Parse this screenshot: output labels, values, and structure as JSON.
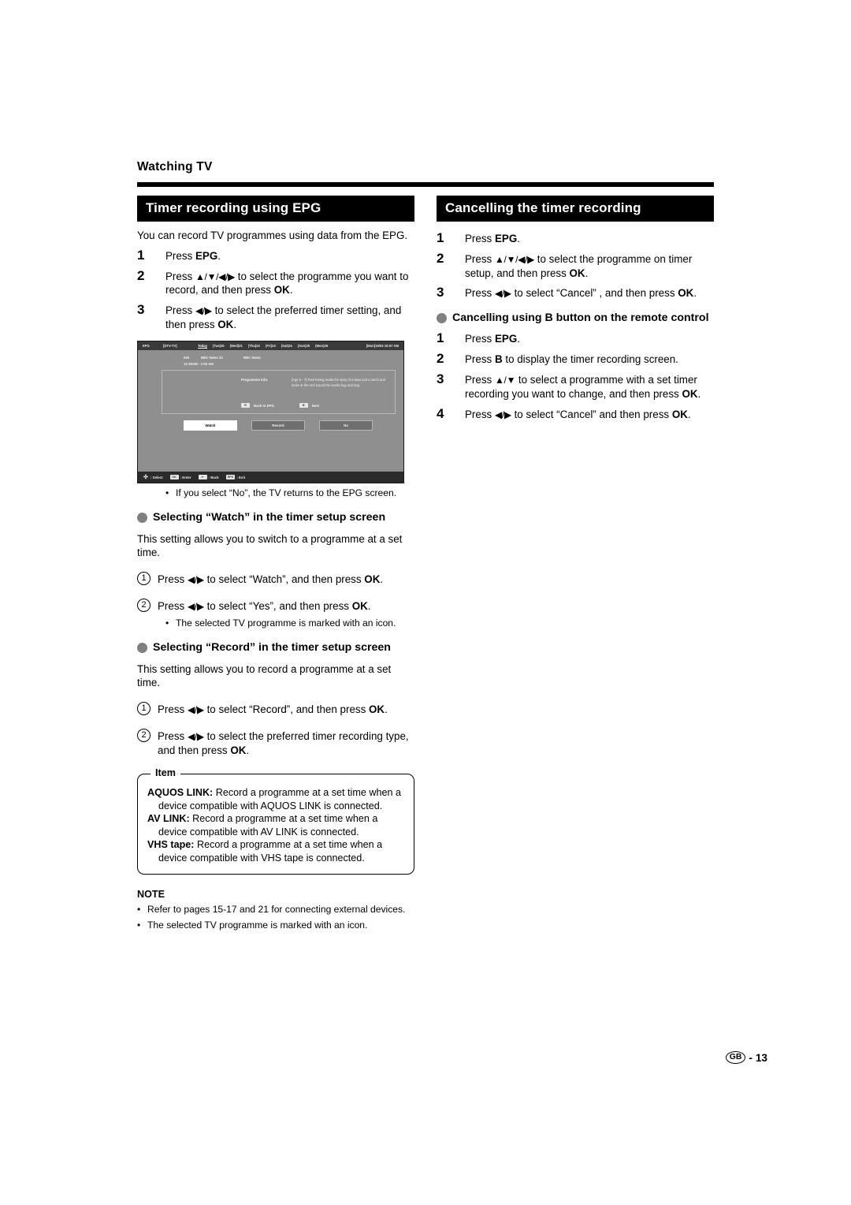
{
  "running_head": "Watching TV",
  "left": {
    "section_title": "Timer recording using EPG",
    "intro": "You can record TV programmes using data from the EPG.",
    "steps": [
      {
        "num": "1",
        "text_html": "Press <b>EPG</b>."
      },
      {
        "num": "2",
        "text_html": "Press <span class=\"arrows\">▲/▼/◀/▶</span> to select the programme you want to record, and then press <b>OK</b>."
      },
      {
        "num": "3",
        "text_html": "Press <span class=\"arrows\">◀/▶</span> to select the preferred timer setting, and then press <b>OK</b>."
      }
    ],
    "epg_note": "If you select “No”, the TV returns to the EPG screen.",
    "watch_section": {
      "heading": "Selecting “Watch” in the timer setup screen",
      "intro": "This setting allows you to switch to a programme at a set time.",
      "steps": [
        {
          "num": "1",
          "text_html": "Press <span class=\"arrows\">◀/▶</span> to select “Watch”, and then press <b>OK</b>."
        },
        {
          "num": "2",
          "text_html": "Press <span class=\"arrows\">◀/▶</span> to select “Yes”, and then press <b>OK</b>."
        }
      ],
      "note": "The selected TV programme is marked with an icon."
    },
    "record_section": {
      "heading": "Selecting “Record” in the timer setup screen",
      "intro": "This setting allows you to record a programme at a set time.",
      "steps": [
        {
          "num": "1",
          "text_html": "Press <span class=\"arrows\">◀/▶</span> to select “Record”, and then press <b>OK</b>."
        },
        {
          "num": "2",
          "text_html": "Press <span class=\"arrows\">◀/▶</span> to select the preferred timer recording type, and then press <b>OK</b>."
        }
      ]
    },
    "item_box": {
      "title": "Item",
      "entries": [
        {
          "term": "AQUOS LINK:",
          "desc": " Record a programme at a set time when a device compatible with AQUOS LINK is connected."
        },
        {
          "term": "AV LINK:",
          "desc": " Record a programme at a set time when a device compatible with AV LINK is connected."
        },
        {
          "term": "VHS tape:",
          "desc": " Record a programme at a set time when a device compatible with VHS tape is connected."
        }
      ]
    },
    "note": {
      "title": "NOTE",
      "bullets": [
        "Refer to pages 15-17 and 21 for connecting external devices.",
        "The selected TV programme is marked with an icon."
      ]
    }
  },
  "right": {
    "section_title": "Cancelling the timer recording",
    "steps": [
      {
        "num": "1",
        "text_html": "Press <b>EPG</b>."
      },
      {
        "num": "2",
        "text_html": "Press <span class=\"arrows\">▲/▼/◀/▶</span> to select the programme on timer setup, and then press <b>OK</b>."
      },
      {
        "num": "3",
        "text_html": "Press <span class=\"arrows\">◀/▶</span> to select “Cancel” , and then press <b>OK</b>."
      }
    ],
    "b_button_section": {
      "heading": "Cancelling using B button on the remote control",
      "steps": [
        {
          "num": "1",
          "text_html": "Press <b>EPG</b>."
        },
        {
          "num": "2",
          "text_html": "Press <b>B</b> to display the timer recording screen."
        },
        {
          "num": "3",
          "text_html": "Press <span class=\"arrows\">▲/▼</span> to select a programme with a set timer recording you want to change, and then press <b>OK</b>."
        },
        {
          "num": "4",
          "text_html": "Press <span class=\"arrows\">◀/▶</span> to select “Cancel” and then press <b>OK</b>."
        }
      ]
    }
  },
  "epg_screenshot": {
    "topbar": {
      "label": "EPG",
      "source": "[DTV-TV]",
      "days": [
        "Today",
        "(Tue)20",
        "(Wed)21",
        "(Thu)22",
        "(Fri)23",
        "(Sat)24",
        "(Sun)25",
        "(Mon)26"
      ],
      "today_index": 0,
      "clock": "[Mon]16/04 10:57 AM"
    },
    "programme": {
      "channel_number": "040",
      "channel_name": "BBC News 24",
      "programme_name": "BBC News",
      "time_range": "12:30AM - 1:00 AM",
      "info_label": "Programme Info.",
      "info_text": "[Age 5 - 7] Paul Ewing reads the story of a bear and a lunch and looks at the end sound the words bug and dog.",
      "key_back": "Back to EPG",
      "key_back_cap": "R",
      "key_next": "Next",
      "key_next_cap": "B"
    },
    "buttons": [
      {
        "label": "Watch",
        "selected": true
      },
      {
        "label": "Record",
        "selected": false
      },
      {
        "label": "No",
        "selected": false
      }
    ],
    "bottombar": [
      {
        "cap": "",
        "label": ": Select",
        "dpad": true
      },
      {
        "cap": "OK",
        "label": ": Enter"
      },
      {
        "cap": "↩",
        "label": ": Back"
      },
      {
        "cap": "EPG",
        "label": ": Exit"
      }
    ]
  },
  "footer": {
    "region": "GB",
    "separator": "-",
    "page_number": "13"
  }
}
